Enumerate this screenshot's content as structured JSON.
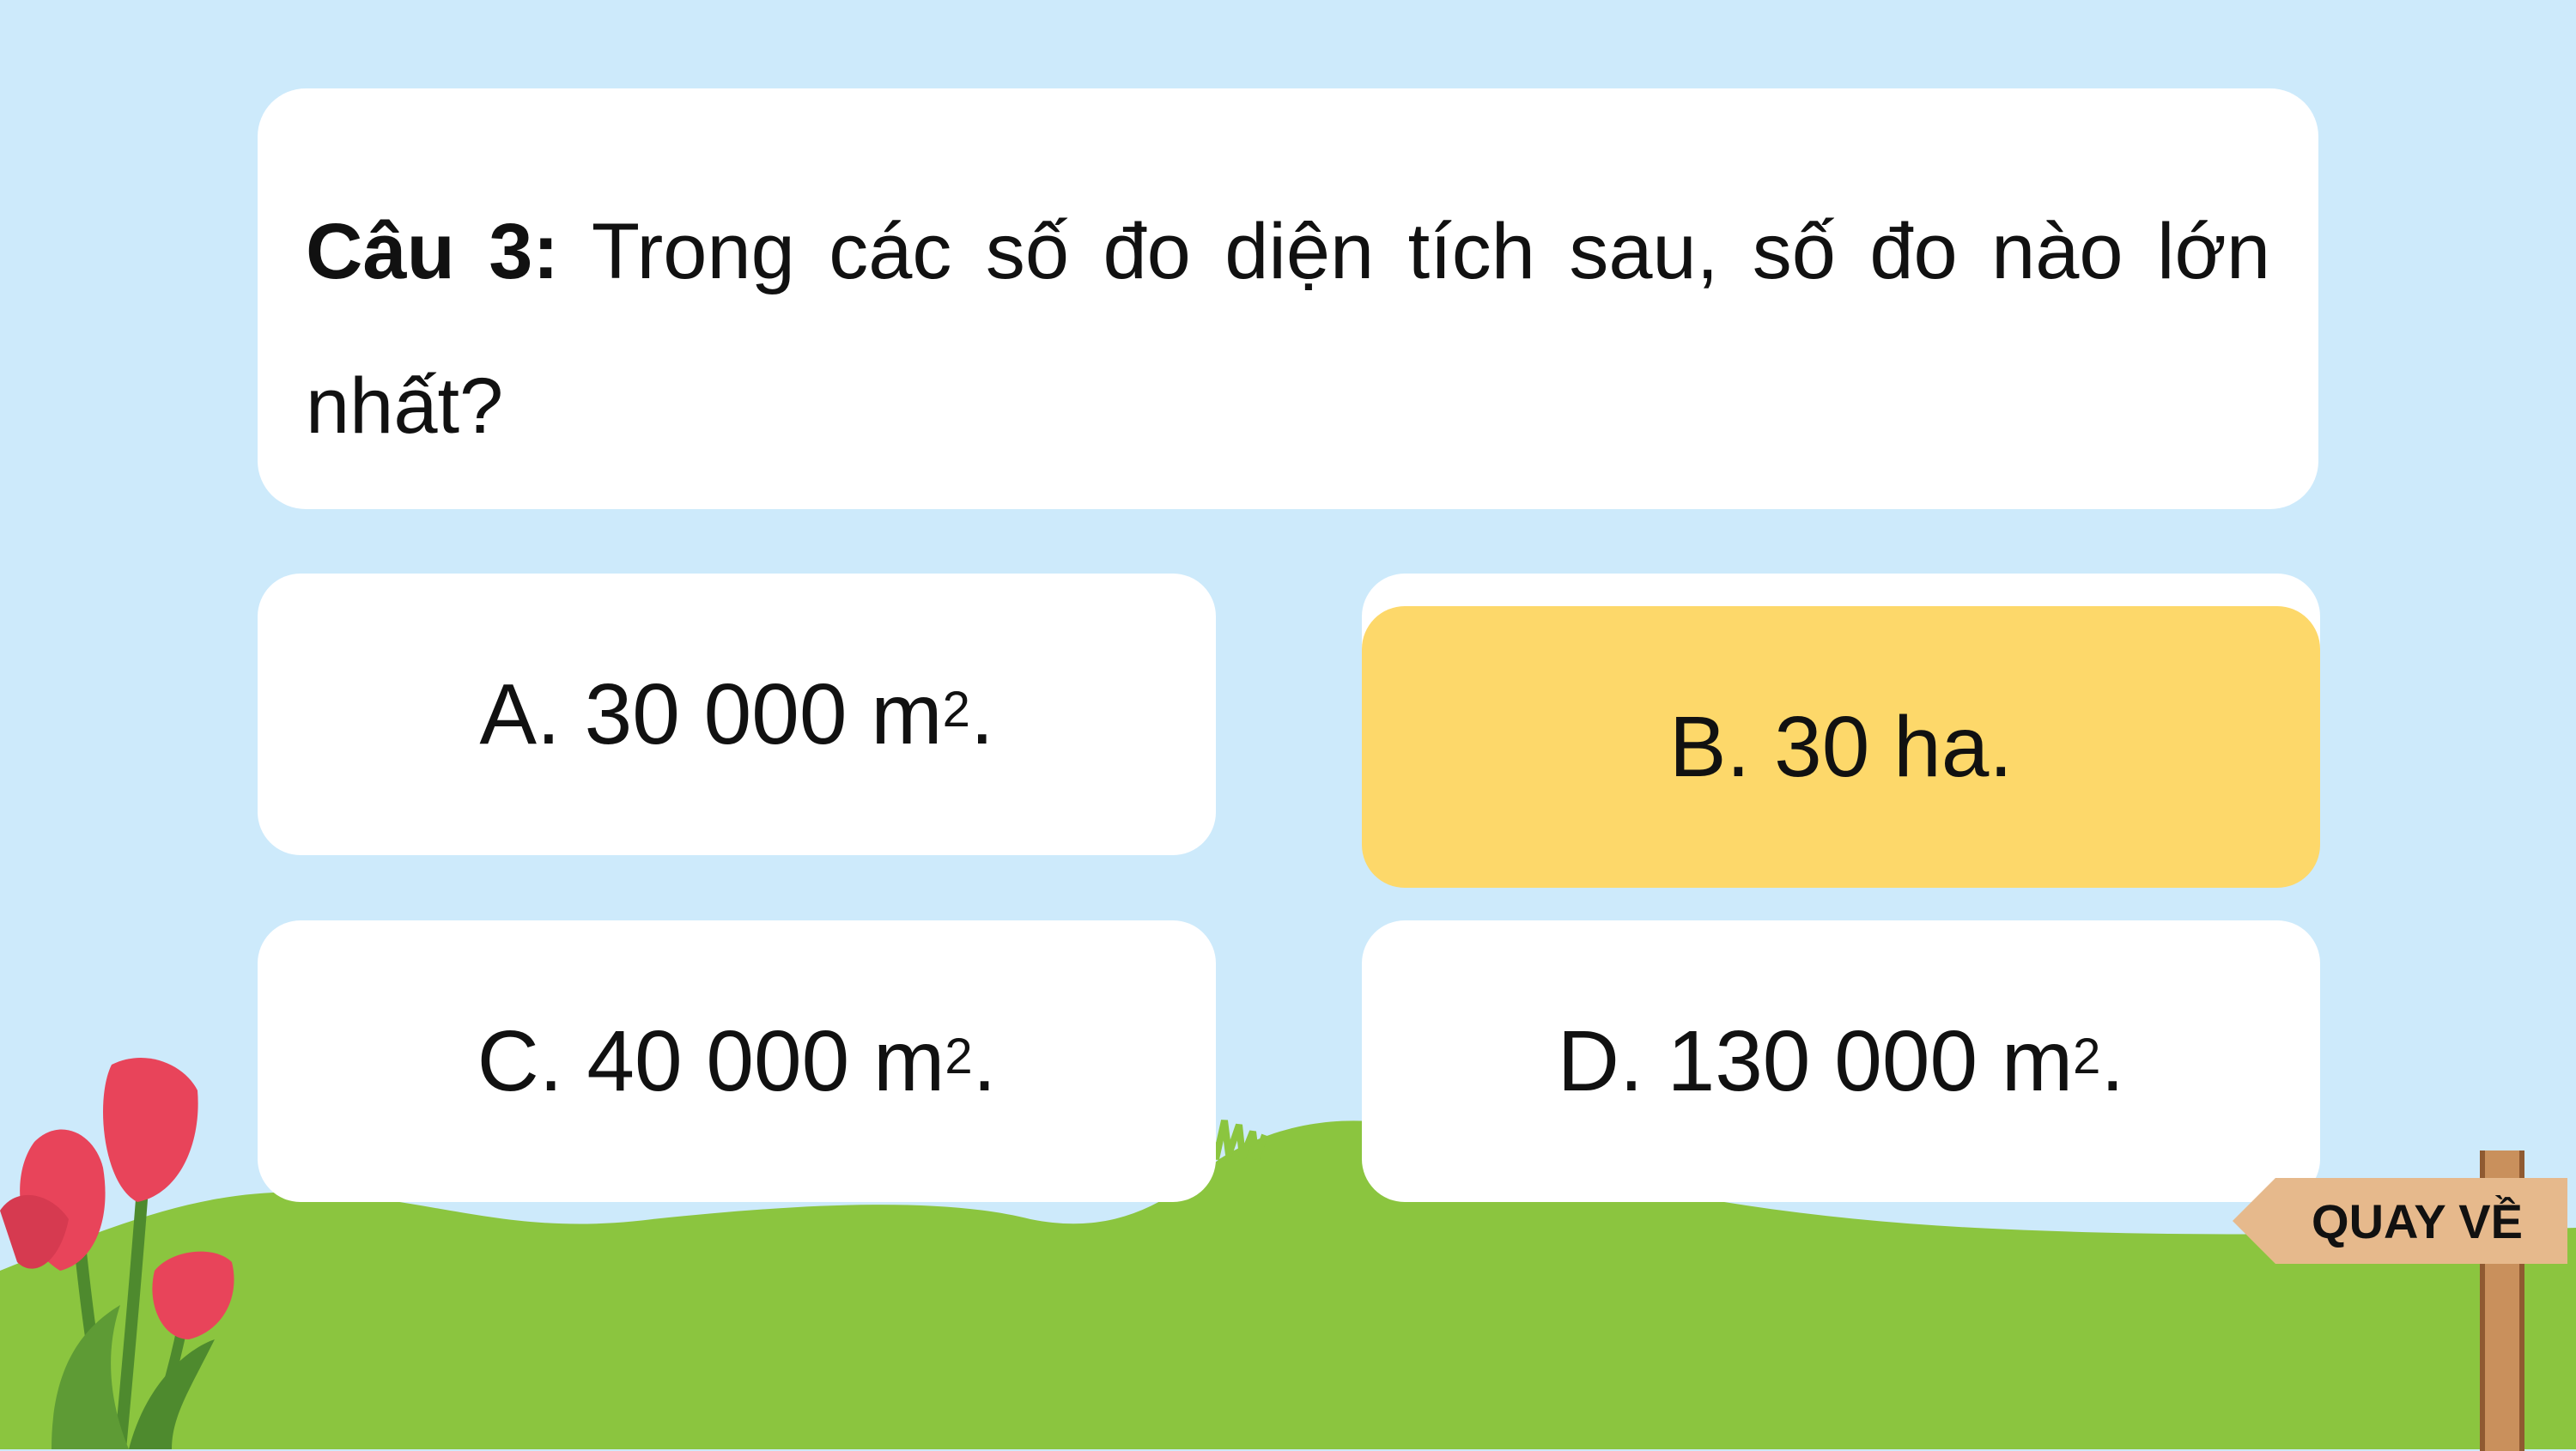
{
  "question": {
    "label": "Câu 3:",
    "text": "Trong các số đo diện tích sau, số đo nào lớn nhất?"
  },
  "answers": [
    {
      "letter": "A.",
      "value": "30 000 m",
      "exponent": "2",
      "suffix": ".",
      "selected": false
    },
    {
      "letter": "B.",
      "value": "30 ha.",
      "exponent": "",
      "suffix": "",
      "selected": true
    },
    {
      "letter": "C.",
      "value": "40 000 m",
      "exponent": "2",
      "suffix": ".",
      "selected": false
    },
    {
      "letter": "D.",
      "value": "130 000 m",
      "exponent": "2",
      "suffix": ".",
      "selected": false
    }
  ],
  "back_button": {
    "label": "QUAY VỀ"
  },
  "colors": {
    "sky": "#cdeafb",
    "grass": "#8bc53f",
    "card": "#ffffff",
    "highlight": "#fdd86a",
    "tulip": "#e8445a"
  },
  "icons": [
    "tulip-flowers-icon",
    "wooden-signpost-icon"
  ]
}
